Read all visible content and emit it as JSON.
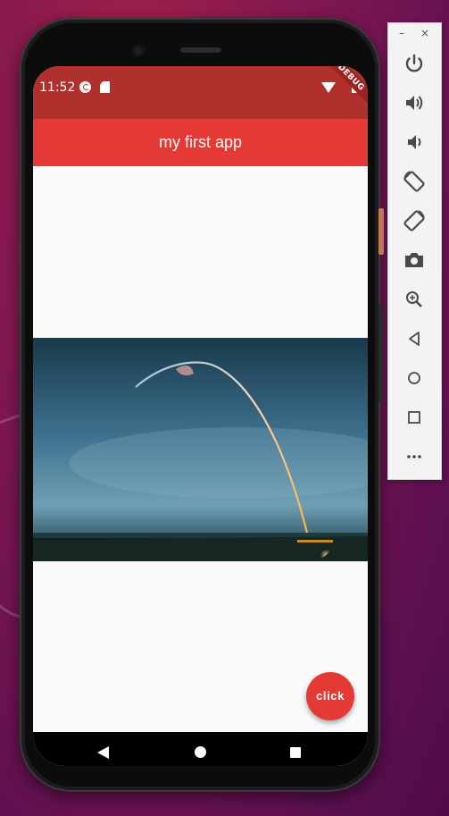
{
  "status_bar": {
    "time": "11:52"
  },
  "debug_banner": "DEBUG",
  "app_bar": {
    "title": "my first app"
  },
  "fab": {
    "label": "click"
  },
  "toolbar": {
    "minimize": "–",
    "close": "×",
    "buttons": [
      "power-icon",
      "volume-up-icon",
      "volume-down-icon",
      "rotate-left-icon",
      "rotate-right-icon",
      "camera-icon",
      "zoom-icon",
      "back-icon",
      "home-icon",
      "overview-icon",
      "more-icon"
    ]
  },
  "colors": {
    "status_bar": "#b0302d",
    "app_bar": "#e53935",
    "fab": "#e53935",
    "toolbar_icon": "#4a4a4a"
  }
}
